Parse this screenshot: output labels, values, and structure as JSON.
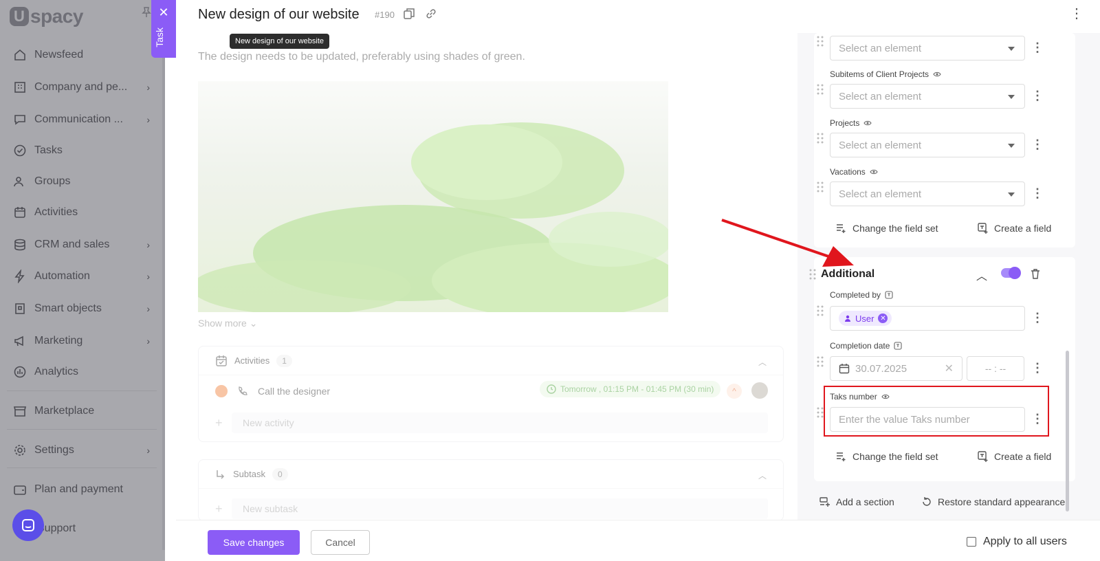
{
  "app": {
    "logo_letter": "U",
    "logo_text": "spacy"
  },
  "sidebar": {
    "items": [
      {
        "label": "Newsfeed",
        "icon": "home-icon",
        "chevron": false
      },
      {
        "label": "Company and pe...",
        "icon": "building-icon",
        "chevron": true
      },
      {
        "label": "Communication ...",
        "icon": "chat-icon",
        "chevron": true
      },
      {
        "label": "Tasks",
        "icon": "check-icon",
        "chevron": false
      },
      {
        "label": "Groups",
        "icon": "users-icon",
        "chevron": false
      },
      {
        "label": "Activities",
        "icon": "calendar-icon",
        "chevron": false
      },
      {
        "label": "CRM and sales",
        "icon": "database-icon",
        "chevron": true
      },
      {
        "label": "Automation",
        "icon": "lightning-icon",
        "chevron": true
      },
      {
        "label": "Smart objects",
        "icon": "cube-icon",
        "chevron": true
      },
      {
        "label": "Marketing",
        "icon": "megaphone-icon",
        "chevron": true
      },
      {
        "label": "Analytics",
        "icon": "chart-icon",
        "chevron": false
      },
      {
        "label": "Marketplace",
        "icon": "store-icon",
        "chevron": false
      },
      {
        "label": "Settings",
        "icon": "gear-icon",
        "chevron": true
      },
      {
        "label": "Plan and payment",
        "icon": "wallet-icon",
        "chevron": false
      },
      {
        "label": "Support",
        "icon": "support-icon",
        "chevron": false
      }
    ]
  },
  "task_tab": {
    "close": "✕",
    "label": "Task"
  },
  "header": {
    "title": "New design of our website",
    "number": "#190",
    "tooltip": "New design of our website",
    "menu": "⋮"
  },
  "description": "The design needs to be updated, preferably using shades of green.",
  "show_more": "Show more",
  "activities": {
    "title": "Activities",
    "count": "1",
    "item": {
      "label": "Call the designer",
      "time": "Tomorrow , 01:15 PM - 01:45 PM (30 min)"
    },
    "new_placeholder": "New activity"
  },
  "subtask": {
    "title": "Subtask",
    "count": "0",
    "new_placeholder": "New subtask"
  },
  "footer": {
    "save": "Save changes",
    "cancel": "Cancel",
    "apply_all": "Apply to all users"
  },
  "settings": {
    "select_placeholder": "Select an element",
    "fields_top": [
      {
        "label": ""
      },
      {
        "label": "Subitems of Client Projects"
      },
      {
        "label": "Projects"
      },
      {
        "label": "Vacations"
      }
    ],
    "change_field_set": "Change the field set",
    "create_field": "Create a field",
    "additional": {
      "title": "Additional",
      "completed_by_label": "Completed by",
      "user_chip": "User",
      "completion_date_label": "Completion date",
      "date_value": "30.07.2025",
      "time_placeholder": "-- : --",
      "taks_number_label": "Taks number",
      "taks_number_placeholder": "Enter the value Taks number"
    },
    "add_section": "Add a section",
    "restore": "Restore standard appearance"
  },
  "colors": {
    "accent": "#8b5cf6",
    "highlight": "#e0161d",
    "chip_green": "#52a543"
  }
}
